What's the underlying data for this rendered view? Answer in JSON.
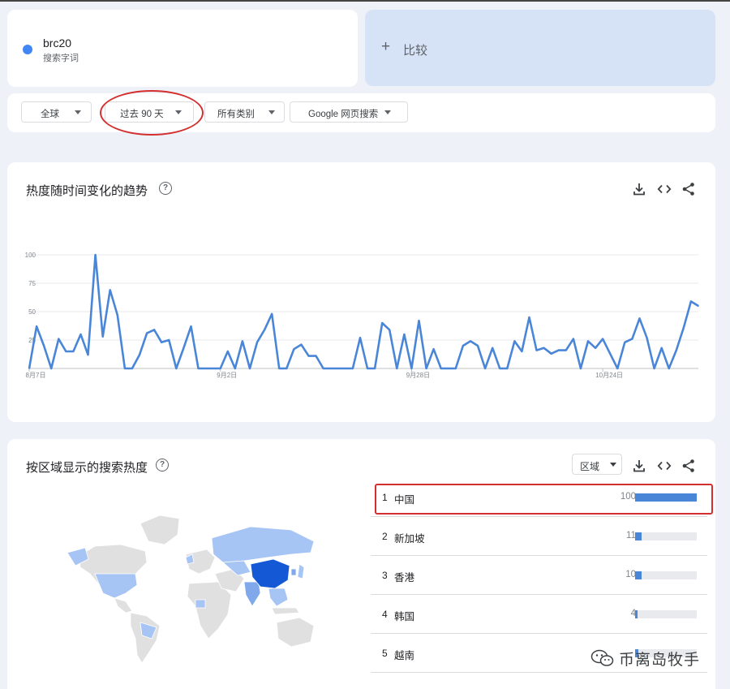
{
  "search_term": {
    "name": "brc20",
    "subtitle": "搜索字词",
    "dot_color": "#4285f4"
  },
  "compare": {
    "plus": "+",
    "label": "比较"
  },
  "filters": {
    "region": "全球",
    "period": "过去 90 天",
    "category": "所有类别",
    "property": "Google 网页搜索"
  },
  "trend": {
    "title": "热度随时间变化的趋势",
    "help": "?",
    "icons": [
      "download-icon",
      "embed-code-icon",
      "share-icon"
    ]
  },
  "chart_data": {
    "type": "line",
    "title": "",
    "xlabel": "",
    "ylabel": "",
    "ylim": [
      0,
      100
    ],
    "y_ticks": [
      25,
      50,
      75,
      100
    ],
    "x_ticks": [
      "8月7日",
      "9月2日",
      "9月28日",
      "10月24日"
    ],
    "x_start_date": "2023-08-07",
    "x_tick_index": [
      0,
      26,
      52,
      78
    ],
    "grid": true,
    "color": "#4a86d8",
    "values": [
      0,
      37,
      20,
      0,
      26,
      15,
      15,
      30,
      12,
      100,
      28,
      69,
      47,
      0,
      0,
      12,
      31,
      34,
      23,
      25,
      0,
      18,
      37,
      0,
      0,
      0,
      0,
      15,
      0,
      24,
      0,
      23,
      34,
      48,
      0,
      0,
      17,
      21,
      11,
      11,
      0,
      0,
      0,
      0,
      0,
      27,
      0,
      0,
      40,
      34,
      0,
      30,
      0,
      42,
      0,
      17,
      0,
      0,
      0,
      20,
      24,
      20,
      0,
      18,
      0,
      0,
      24,
      15,
      45,
      16,
      18,
      13,
      16,
      16,
      26,
      0,
      24,
      18,
      26,
      13,
      0,
      23,
      26,
      44,
      27,
      0,
      18,
      0,
      16,
      36,
      59,
      55
    ]
  },
  "region": {
    "title": "按区域显示的搜索热度",
    "help": "?",
    "select_label": "区域",
    "rows": [
      {
        "rank": "1",
        "name": "中国",
        "value": 100,
        "value_label": "100"
      },
      {
        "rank": "2",
        "name": "新加坡",
        "value": 11,
        "value_label": "11"
      },
      {
        "rank": "3",
        "name": "香港",
        "value": 10,
        "value_label": "10"
      },
      {
        "rank": "4",
        "name": "韩国",
        "value": 4,
        "value_label": "4"
      },
      {
        "rank": "5",
        "name": "越南",
        "value": 5,
        "value_label": ""
      }
    ],
    "bar_color": "#4a86d8",
    "map_colors": {
      "none": "#e0e0e0",
      "low": "#a6c4f4",
      "mid": "#7fa9ea",
      "high": "#1558d6"
    }
  },
  "watermark": {
    "text": "币离岛牧手"
  },
  "annotation_color": "#d32f2f"
}
